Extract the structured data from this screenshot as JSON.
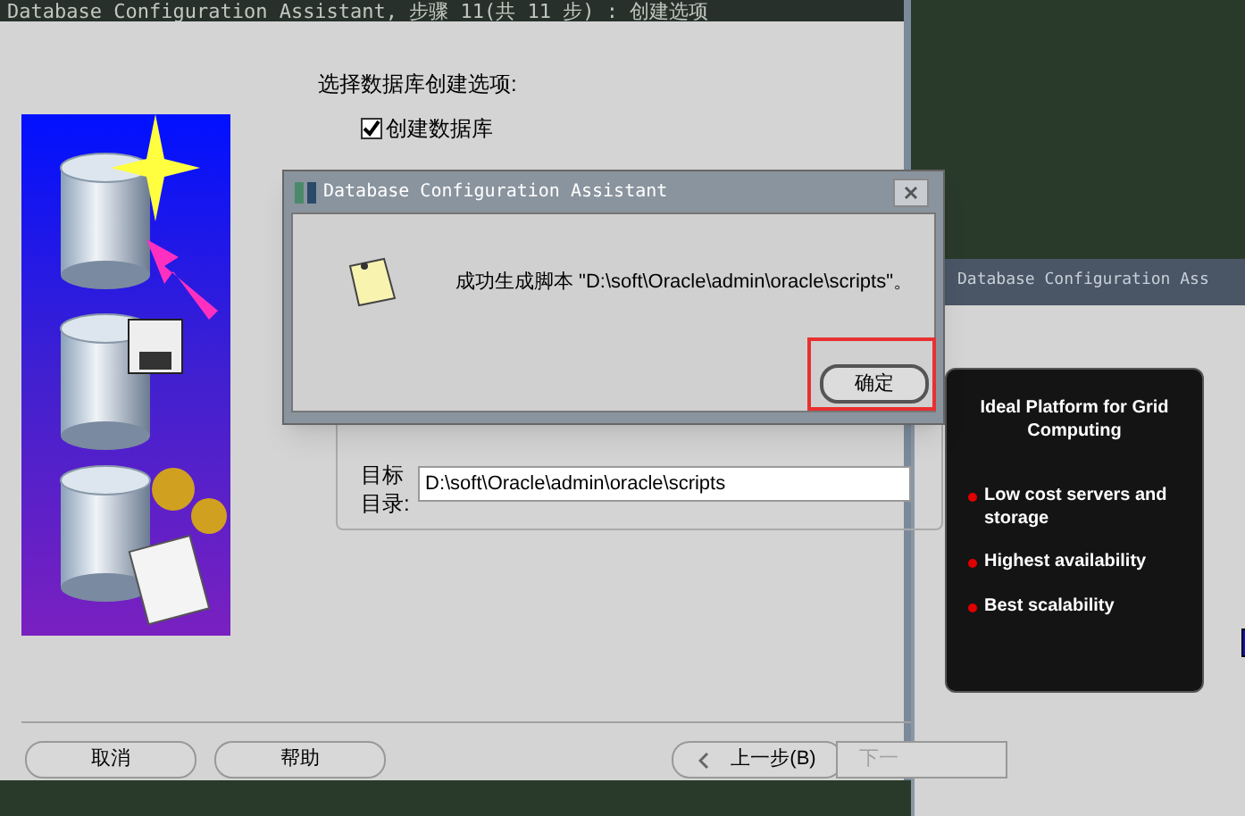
{
  "main_window": {
    "title": "Database Configuration Assistant, 步骤 11(共 11 步) : 创建选项",
    "prompt": "选择数据库创建选项:",
    "options": [
      {
        "label": "创建数据库",
        "checked": true
      }
    ],
    "target_label": "目标目录:",
    "target_value": "D:\\soft\\Oracle\\admin\\oracle\\scripts",
    "buttons": [
      {
        "label": "取消",
        "kind": "plain",
        "disabled": false
      },
      {
        "label": "帮助",
        "kind": "plain",
        "disabled": false
      },
      {
        "label": "上一步(B)",
        "kind": "back",
        "disabled": false
      },
      {
        "label": "下一",
        "kind": "plain",
        "disabled": true
      }
    ]
  },
  "dialog": {
    "title": "Database Configuration Assistant",
    "message": "成功生成脚本 \"D:\\soft\\Oracle\\admin\\oracle\\scripts\"。",
    "ok": "确定",
    "highlighted": true
  },
  "side_window": {
    "title": "Database Configuration Ass",
    "promo_title": "Ideal Platform for Grid Computing",
    "promo_items": [
      "Low cost servers and storage",
      "Highest availability",
      "Best scalability"
    ]
  }
}
